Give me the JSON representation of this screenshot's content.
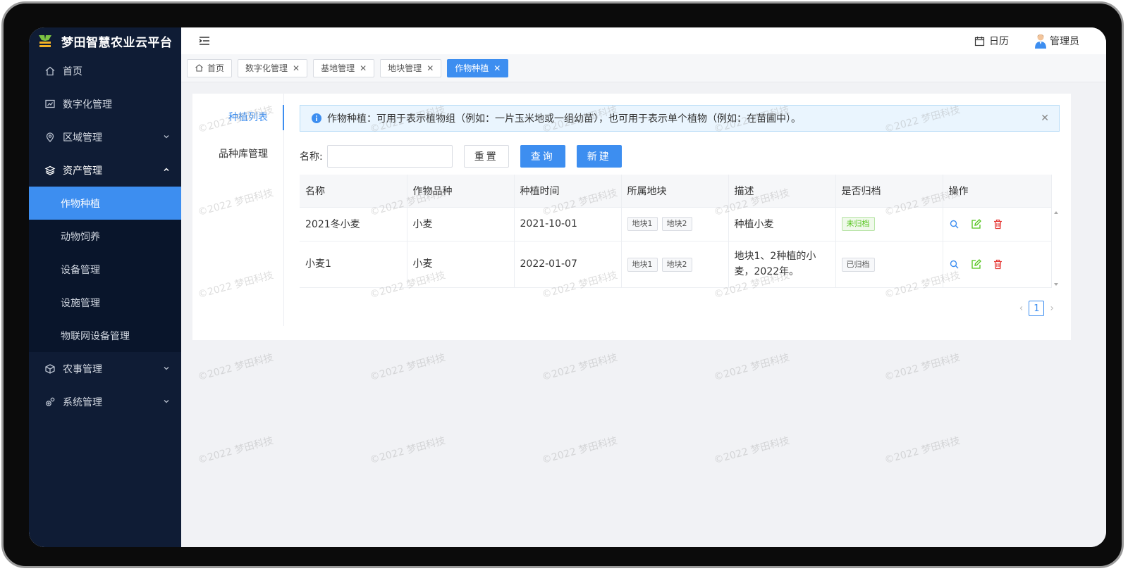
{
  "app": {
    "title": "梦田智慧农业云平台",
    "logo_icon": "sprout-logo-icon"
  },
  "sidebar": {
    "items": [
      {
        "label": "首页",
        "icon": "home-icon"
      },
      {
        "label": "数字化管理",
        "icon": "chart-board-icon"
      },
      {
        "label": "区域管理",
        "icon": "location-pin-icon"
      },
      {
        "label": "资产管理",
        "icon": "layers-icon"
      },
      {
        "label": "农事管理",
        "icon": "cube-icon"
      },
      {
        "label": "系统管理",
        "icon": "gears-icon"
      }
    ],
    "asset_sub_items": [
      "作物种植",
      "动物饲养",
      "设备管理",
      "设施管理",
      "物联网设备管理"
    ],
    "active_sub_item": "作物种植"
  },
  "topbar": {
    "calendar_label": "日历",
    "user_label": "管理员"
  },
  "tabs": [
    {
      "label": "首页"
    },
    {
      "label": "数字化管理"
    },
    {
      "label": "基地管理"
    },
    {
      "label": "地块管理"
    },
    {
      "label": "作物种植"
    }
  ],
  "subnav": {
    "items": [
      "种植列表",
      "品种库管理"
    ],
    "active": "种植列表"
  },
  "alert": {
    "text": "作物种植：可用于表示植物组（例如：一片玉米地或一组幼苗），也可用于表示单个植物（例如：在苗圃中）。"
  },
  "search": {
    "label": "名称:",
    "value": "",
    "placeholder": ""
  },
  "buttons": {
    "reset": "重置",
    "query": "查询",
    "create": "新建"
  },
  "table": {
    "columns": [
      "名称",
      "作物品种",
      "种植时间",
      "所属地块",
      "描述",
      "是否归档",
      "操作"
    ],
    "rows": [
      {
        "name": "2021冬小麦",
        "variety": "小麦",
        "date": "2021-10-01",
        "plots": [
          "地块1",
          "地块2"
        ],
        "desc": "种植小麦",
        "archived": "未归档"
      },
      {
        "name": "小麦1",
        "variety": "小麦",
        "date": "2022-01-07",
        "plots": [
          "地块1",
          "地块2"
        ],
        "desc": "地块1、2种植的小麦，2022年。",
        "archived": "已归档"
      }
    ]
  },
  "pagination": {
    "current": "1"
  },
  "watermark": "©2022 梦田科技",
  "colors": {
    "primary": "#3d8ef0",
    "sidebar_bg": "#0f1c35",
    "success": "#52c41a",
    "danger": "#e53935"
  }
}
